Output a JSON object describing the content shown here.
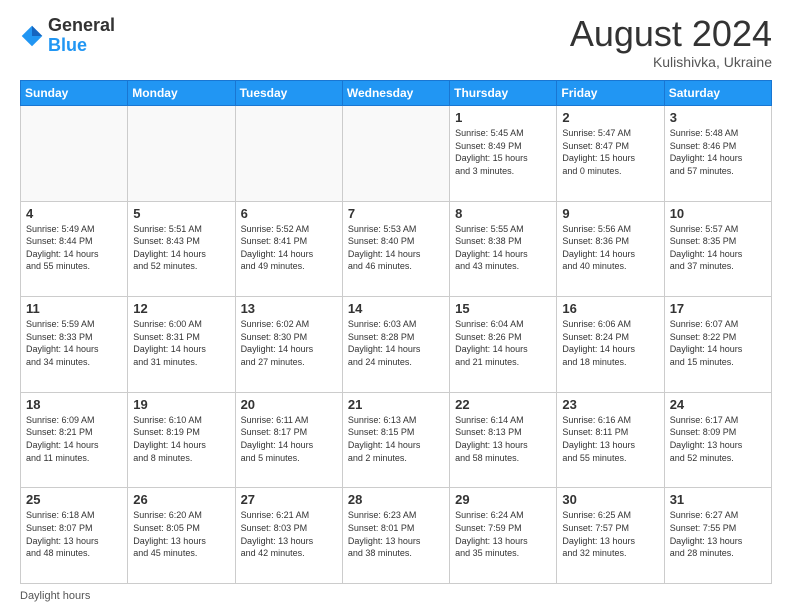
{
  "header": {
    "logo_line1": "General",
    "logo_line2": "Blue",
    "month_year": "August 2024",
    "location": "Kulishivka, Ukraine"
  },
  "footer": {
    "daylight_label": "Daylight hours"
  },
  "days_of_week": [
    "Sunday",
    "Monday",
    "Tuesday",
    "Wednesday",
    "Thursday",
    "Friday",
    "Saturday"
  ],
  "weeks": [
    [
      {
        "day": "",
        "info": ""
      },
      {
        "day": "",
        "info": ""
      },
      {
        "day": "",
        "info": ""
      },
      {
        "day": "",
        "info": ""
      },
      {
        "day": "1",
        "info": "Sunrise: 5:45 AM\nSunset: 8:49 PM\nDaylight: 15 hours\nand 3 minutes."
      },
      {
        "day": "2",
        "info": "Sunrise: 5:47 AM\nSunset: 8:47 PM\nDaylight: 15 hours\nand 0 minutes."
      },
      {
        "day": "3",
        "info": "Sunrise: 5:48 AM\nSunset: 8:46 PM\nDaylight: 14 hours\nand 57 minutes."
      }
    ],
    [
      {
        "day": "4",
        "info": "Sunrise: 5:49 AM\nSunset: 8:44 PM\nDaylight: 14 hours\nand 55 minutes."
      },
      {
        "day": "5",
        "info": "Sunrise: 5:51 AM\nSunset: 8:43 PM\nDaylight: 14 hours\nand 52 minutes."
      },
      {
        "day": "6",
        "info": "Sunrise: 5:52 AM\nSunset: 8:41 PM\nDaylight: 14 hours\nand 49 minutes."
      },
      {
        "day": "7",
        "info": "Sunrise: 5:53 AM\nSunset: 8:40 PM\nDaylight: 14 hours\nand 46 minutes."
      },
      {
        "day": "8",
        "info": "Sunrise: 5:55 AM\nSunset: 8:38 PM\nDaylight: 14 hours\nand 43 minutes."
      },
      {
        "day": "9",
        "info": "Sunrise: 5:56 AM\nSunset: 8:36 PM\nDaylight: 14 hours\nand 40 minutes."
      },
      {
        "day": "10",
        "info": "Sunrise: 5:57 AM\nSunset: 8:35 PM\nDaylight: 14 hours\nand 37 minutes."
      }
    ],
    [
      {
        "day": "11",
        "info": "Sunrise: 5:59 AM\nSunset: 8:33 PM\nDaylight: 14 hours\nand 34 minutes."
      },
      {
        "day": "12",
        "info": "Sunrise: 6:00 AM\nSunset: 8:31 PM\nDaylight: 14 hours\nand 31 minutes."
      },
      {
        "day": "13",
        "info": "Sunrise: 6:02 AM\nSunset: 8:30 PM\nDaylight: 14 hours\nand 27 minutes."
      },
      {
        "day": "14",
        "info": "Sunrise: 6:03 AM\nSunset: 8:28 PM\nDaylight: 14 hours\nand 24 minutes."
      },
      {
        "day": "15",
        "info": "Sunrise: 6:04 AM\nSunset: 8:26 PM\nDaylight: 14 hours\nand 21 minutes."
      },
      {
        "day": "16",
        "info": "Sunrise: 6:06 AM\nSunset: 8:24 PM\nDaylight: 14 hours\nand 18 minutes."
      },
      {
        "day": "17",
        "info": "Sunrise: 6:07 AM\nSunset: 8:22 PM\nDaylight: 14 hours\nand 15 minutes."
      }
    ],
    [
      {
        "day": "18",
        "info": "Sunrise: 6:09 AM\nSunset: 8:21 PM\nDaylight: 14 hours\nand 11 minutes."
      },
      {
        "day": "19",
        "info": "Sunrise: 6:10 AM\nSunset: 8:19 PM\nDaylight: 14 hours\nand 8 minutes."
      },
      {
        "day": "20",
        "info": "Sunrise: 6:11 AM\nSunset: 8:17 PM\nDaylight: 14 hours\nand 5 minutes."
      },
      {
        "day": "21",
        "info": "Sunrise: 6:13 AM\nSunset: 8:15 PM\nDaylight: 14 hours\nand 2 minutes."
      },
      {
        "day": "22",
        "info": "Sunrise: 6:14 AM\nSunset: 8:13 PM\nDaylight: 13 hours\nand 58 minutes."
      },
      {
        "day": "23",
        "info": "Sunrise: 6:16 AM\nSunset: 8:11 PM\nDaylight: 13 hours\nand 55 minutes."
      },
      {
        "day": "24",
        "info": "Sunrise: 6:17 AM\nSunset: 8:09 PM\nDaylight: 13 hours\nand 52 minutes."
      }
    ],
    [
      {
        "day": "25",
        "info": "Sunrise: 6:18 AM\nSunset: 8:07 PM\nDaylight: 13 hours\nand 48 minutes."
      },
      {
        "day": "26",
        "info": "Sunrise: 6:20 AM\nSunset: 8:05 PM\nDaylight: 13 hours\nand 45 minutes."
      },
      {
        "day": "27",
        "info": "Sunrise: 6:21 AM\nSunset: 8:03 PM\nDaylight: 13 hours\nand 42 minutes."
      },
      {
        "day": "28",
        "info": "Sunrise: 6:23 AM\nSunset: 8:01 PM\nDaylight: 13 hours\nand 38 minutes."
      },
      {
        "day": "29",
        "info": "Sunrise: 6:24 AM\nSunset: 7:59 PM\nDaylight: 13 hours\nand 35 minutes."
      },
      {
        "day": "30",
        "info": "Sunrise: 6:25 AM\nSunset: 7:57 PM\nDaylight: 13 hours\nand 32 minutes."
      },
      {
        "day": "31",
        "info": "Sunrise: 6:27 AM\nSunset: 7:55 PM\nDaylight: 13 hours\nand 28 minutes."
      }
    ]
  ]
}
